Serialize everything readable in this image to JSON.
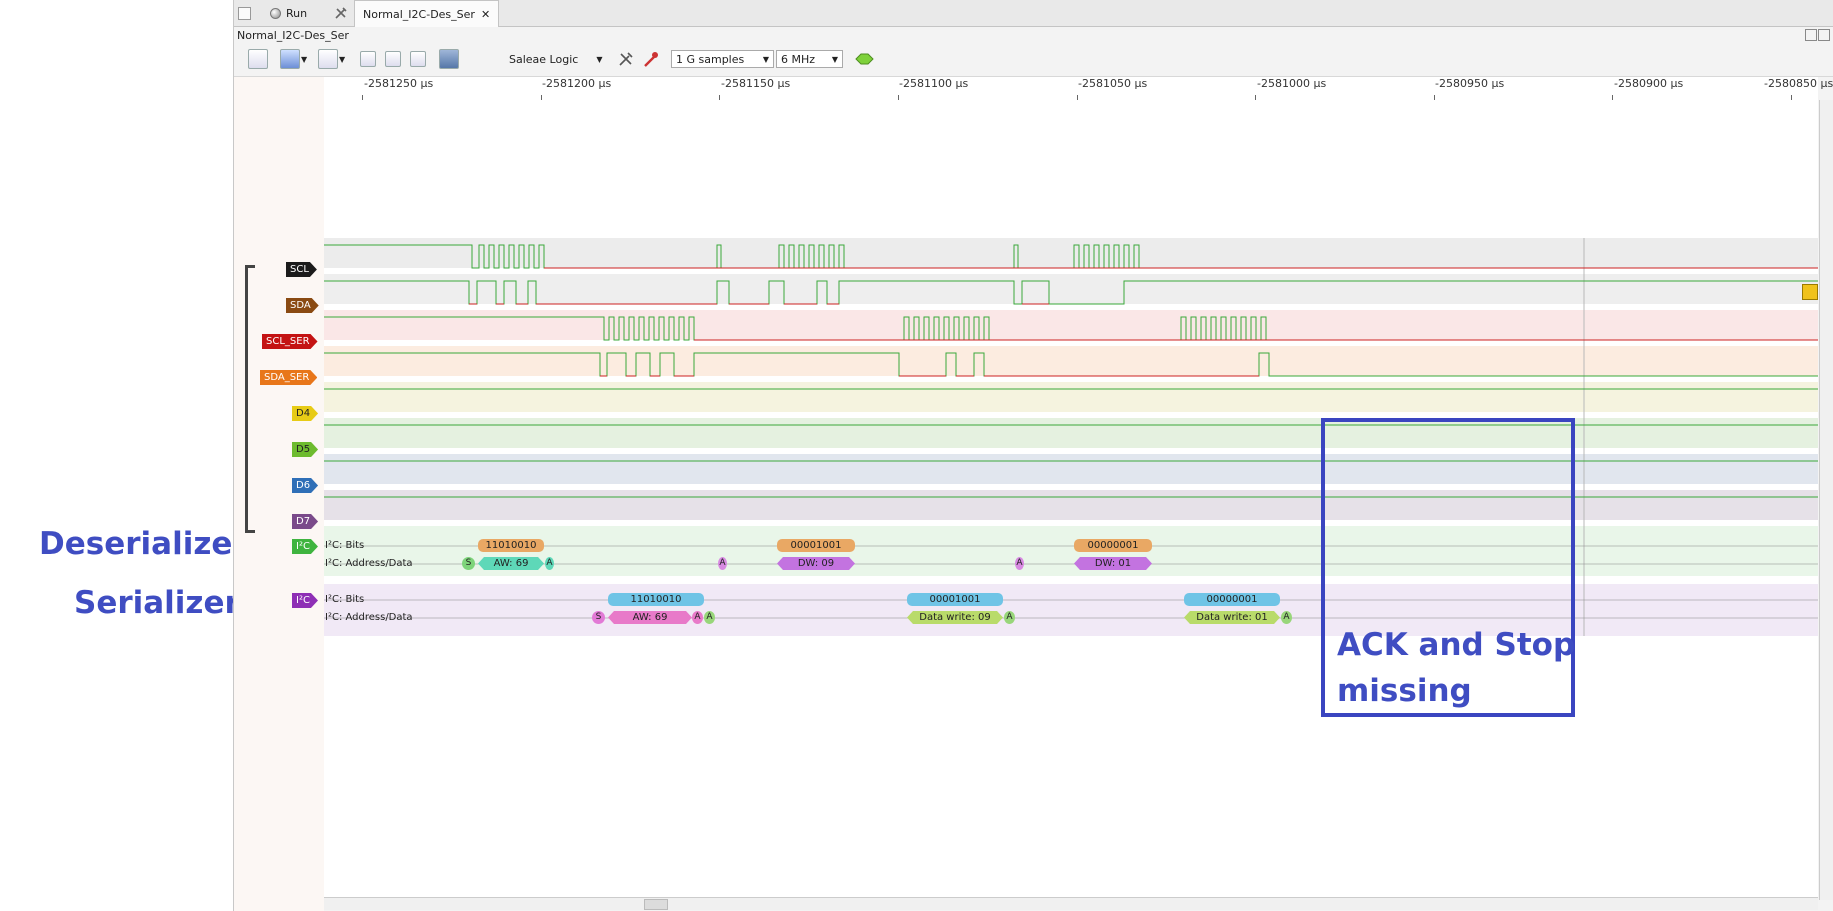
{
  "tabs": {
    "run_label": "Run",
    "doc_tab_label": "Normal_I2C-Des_Ser",
    "close_glyph": "✕"
  },
  "window": {
    "title": "Normal_I2C-Des_Ser"
  },
  "toolbar": {
    "device": "Saleae Logic",
    "sample_count": "1 G samples",
    "sample_rate": "6 MHz"
  },
  "timeline": {
    "ticks": [
      "-2581250 µs",
      "-2581200 µs",
      "-2581150 µs",
      "-2581100 µs",
      "-2581050 µs",
      "-2581000 µs",
      "-2580950 µs",
      "-2580900 µs",
      "-2580850 µs"
    ]
  },
  "channels": [
    {
      "label": "SCL",
      "color": "#1b1b1b"
    },
    {
      "label": "SDA",
      "color": "#8a4a12"
    },
    {
      "label": "SCL_SER",
      "color": "#c41313"
    },
    {
      "label": "SDA_SER",
      "color": "#e8761a"
    },
    {
      "label": "D4",
      "color": "#e7cb16"
    },
    {
      "label": "D5",
      "color": "#6dbb2e"
    },
    {
      "label": "D6",
      "color": "#2f6fb7"
    },
    {
      "label": "D7",
      "color": "#7a4a8a"
    }
  ],
  "analyzers": [
    {
      "badge": "I²C",
      "badge_color": "#3fb43f",
      "rows": [
        "I²C: Bits",
        "I²C: Address/Data"
      ],
      "bits": [
        "11010010",
        "00001001",
        "00000001"
      ],
      "frames": [
        "S",
        "AW: 69",
        "A",
        "A",
        "DW: 09",
        "A",
        "DW: 01"
      ]
    },
    {
      "badge": "I²C",
      "badge_color": "#8e2fb5",
      "rows": [
        "I²C: Bits",
        "I²C: Address/Data"
      ],
      "bits": [
        "11010010",
        "00001001",
        "00000001"
      ],
      "frames": [
        "S",
        "AW: 69",
        "A",
        "A",
        "Data write: 09",
        "A",
        "Data write: 01",
        "A"
      ]
    }
  ],
  "annotations": {
    "deserializer": "Deserializer",
    "serializer": "Serializer",
    "missing_line1": "ACK and Stop",
    "missing_line2": "missing"
  }
}
